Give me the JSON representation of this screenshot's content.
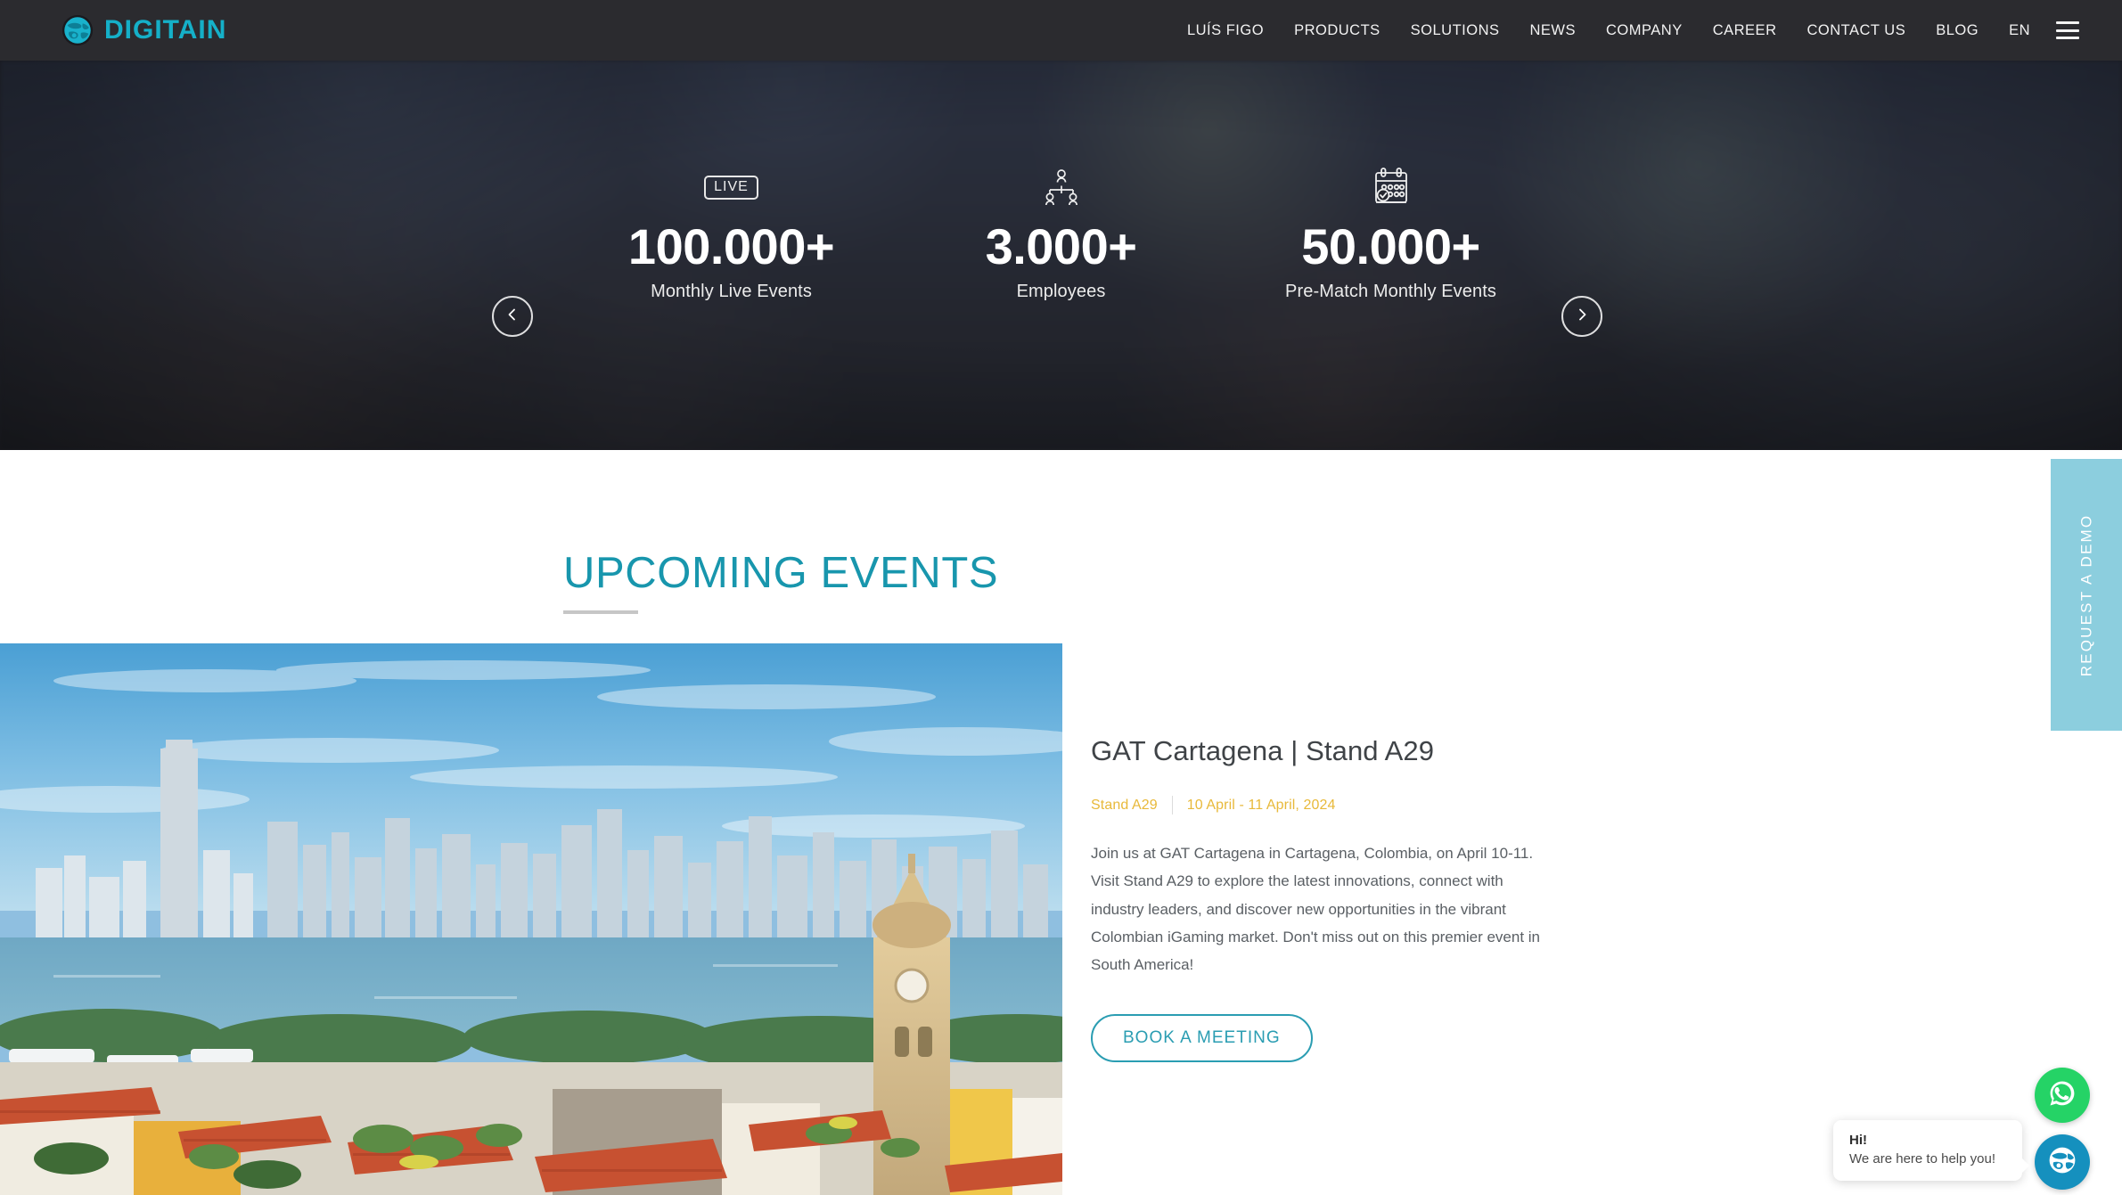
{
  "header": {
    "logo_text": "DIGITAIN",
    "logo_icon": "globe-icon",
    "nav_items": [
      {
        "label": "LUÍS FIGO"
      },
      {
        "label": "PRODUCTS"
      },
      {
        "label": "SOLUTIONS"
      },
      {
        "label": "NEWS"
      },
      {
        "label": "COMPANY"
      },
      {
        "label": "CAREER"
      },
      {
        "label": "CONTACT US"
      },
      {
        "label": "BLOG"
      }
    ],
    "language": "EN",
    "menu_icon": "hamburger-menu-icon",
    "background_color": "#2b2b2f",
    "accent_color": "#15b0c8"
  },
  "hero": {
    "prev_icon": "chevron-left-icon",
    "next_icon": "chevron-right-icon",
    "stats": [
      {
        "icon": "live-badge-icon",
        "icon_label": "LIVE",
        "value": "100.000+",
        "label": "Monthly Live Events"
      },
      {
        "icon": "people-group-icon",
        "icon_label": "",
        "value": "3.000+",
        "label": "Employees"
      },
      {
        "icon": "calendar-check-icon",
        "icon_label": "",
        "value": "50.000+",
        "label": "Pre-Match Monthly Events"
      }
    ]
  },
  "events_section": {
    "title": "UPCOMING EVENTS",
    "title_color": "#1896ad",
    "event": {
      "image_alt": "Cartagena Colombia skyline and old town rooftops",
      "title": "GAT Cartagena | Stand A29",
      "stand": "Stand A29",
      "dates": "10 April - 11 April, 2024",
      "meta_color": "#e8b93a",
      "description": "Join us at GAT Cartagena in Cartagena, Colombia, on April 10-11. Visit Stand A29 to explore the latest innovations, connect with industry leaders, and discover new opportunities in the vibrant Colombian iGaming market. Don't miss out on this premier event in South America!",
      "cta_label": "BOOK A MEETING",
      "cta_color": "#2a9db2"
    }
  },
  "demo_tab": {
    "label": "REQUEST A DEMO",
    "background_color": "#8ccede"
  },
  "chat": {
    "whatsapp_icon": "whatsapp-icon",
    "whatsapp_color": "#25d366",
    "chat_icon": "digitain-globe-chat-icon",
    "chat_color": "#1590be",
    "bubble_title": "Hi!",
    "bubble_text": "We are here to help you!"
  }
}
